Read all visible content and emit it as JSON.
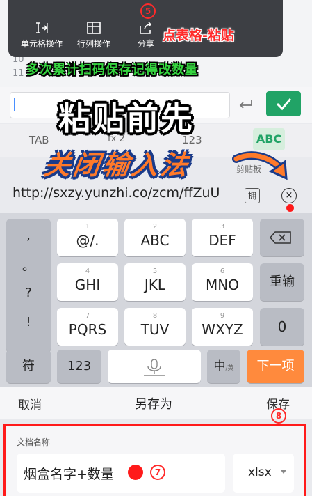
{
  "sheet": {
    "row_numbers": [
      "10",
      "11"
    ]
  },
  "context_menu": {
    "items": [
      {
        "label": "单元格操作",
        "icon": "cell-operation-icon"
      },
      {
        "label": "行列操作",
        "icon": "row-column-icon"
      },
      {
        "label": "分享",
        "icon": "share-icon"
      }
    ],
    "step_number": "5",
    "caption": "点表格-粘贴"
  },
  "captions": {
    "green": "多次累计扫码保存记得改数量",
    "big": "粘贴前先",
    "orange": "关闭输入法"
  },
  "formula_bar": {
    "enter_icon": "return-icon",
    "confirm_icon": "check-icon"
  },
  "toolbar": {
    "tab": "TAB",
    "fx": "fx 2",
    "num": "123",
    "abc": "ABC",
    "clipboard": "剪贴板"
  },
  "clipboard": {
    "url": "http://sxzy.yunzhi.co/zcm/ffZuU",
    "paste_label": "拥",
    "clear_icon": "clear-icon"
  },
  "keyboard": {
    "left_column": [
      ",",
      "。",
      "?",
      "!"
    ],
    "keys": [
      {
        "sub": "1",
        "main": "@/."
      },
      {
        "sub": "2",
        "main": "ABC"
      },
      {
        "sub": "3",
        "main": "DEF"
      },
      {
        "sub": "4",
        "main": "GHI"
      },
      {
        "sub": "5",
        "main": "JKL"
      },
      {
        "sub": "6",
        "main": "MNO"
      },
      {
        "sub": "7",
        "main": "PQRS"
      },
      {
        "sub": "8",
        "main": "TUV"
      },
      {
        "sub": "9",
        "main": "WXYZ"
      }
    ],
    "backspace_icon": "backspace-icon",
    "reenter": "重输",
    "zero": "0",
    "symbols": "符",
    "numbers": "123",
    "space_icon": "microphone-icon",
    "lang": "中",
    "lang_sub": "/英",
    "next": "下一项"
  },
  "action_bar": {
    "cancel": "取消",
    "title": "另存为",
    "save": "保存",
    "save_step": "8"
  },
  "doc_panel": {
    "label": "文档名称",
    "filename": "烟盒名字+数量",
    "step": "7",
    "ext": "xlsx"
  },
  "colors": {
    "accent_green": "#21a366",
    "annotation_red": "#ff1a1a",
    "next_orange": "#ff8a3d"
  }
}
